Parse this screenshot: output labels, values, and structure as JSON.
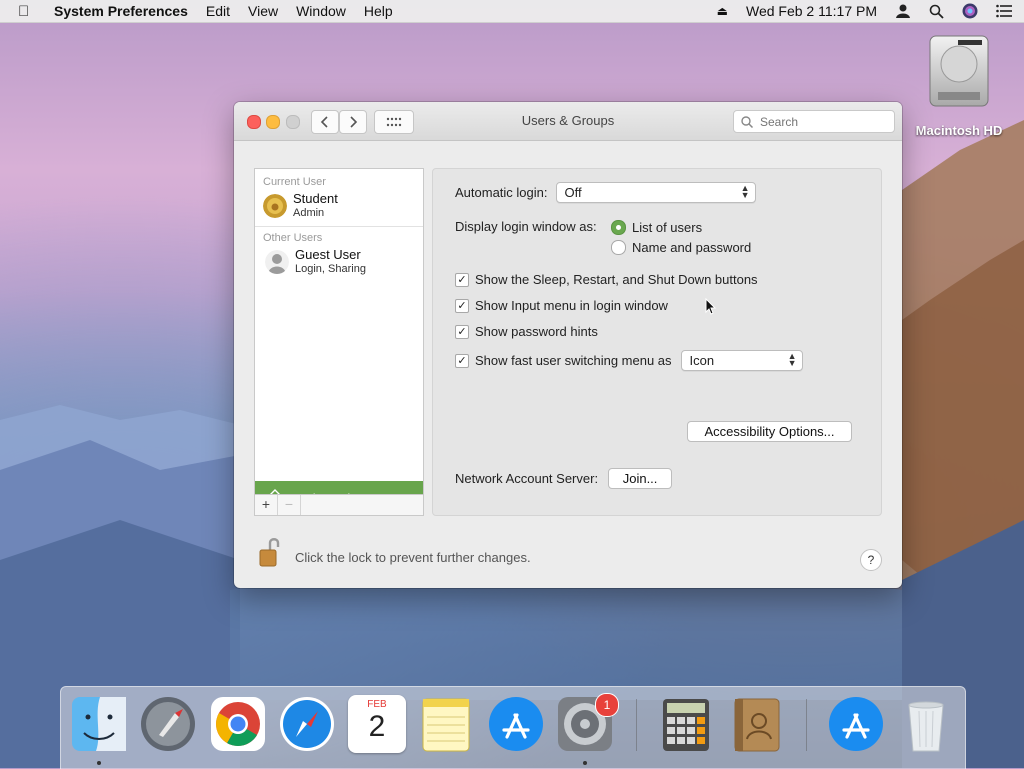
{
  "menubar": {
    "app_name": "System Preferences",
    "items": [
      "Edit",
      "View",
      "Window",
      "Help"
    ],
    "clock": "Wed Feb 2  11:17 PM"
  },
  "desktop": {
    "drive_label": "Macintosh HD"
  },
  "window": {
    "title": "Users & Groups",
    "search_placeholder": "Search"
  },
  "sidebar": {
    "current_user_header": "Current User",
    "current_user": {
      "name": "Student",
      "role": "Admin"
    },
    "other_users_header": "Other Users",
    "other_users": [
      {
        "name": "Guest User",
        "role": "Login, Sharing"
      }
    ],
    "login_options_label": "Login Options",
    "add_label": "+",
    "remove_label": "−"
  },
  "panel": {
    "auto_login_label": "Automatic login:",
    "auto_login_value": "Off",
    "display_as_label": "Display login window as:",
    "radio_list": "List of users",
    "radio_name": "Name and password",
    "check_sleep": "Show the Sleep, Restart, and Shut Down buttons",
    "check_input": "Show Input menu in login window",
    "check_hints": "Show password hints",
    "check_fast": "Show fast user switching menu as",
    "fast_value": "Icon",
    "accessibility_button": "Accessibility Options...",
    "network_label": "Network Account Server:",
    "join_button": "Join..."
  },
  "footer": {
    "lock_text": "Click the lock to prevent further changes.",
    "help": "?"
  },
  "dock": {
    "calendar_month": "FEB",
    "calendar_day": "2",
    "sysprefs_badge": "1"
  },
  "colors": {
    "accent_green": "#68a54c",
    "badge_red": "#e8413b"
  }
}
